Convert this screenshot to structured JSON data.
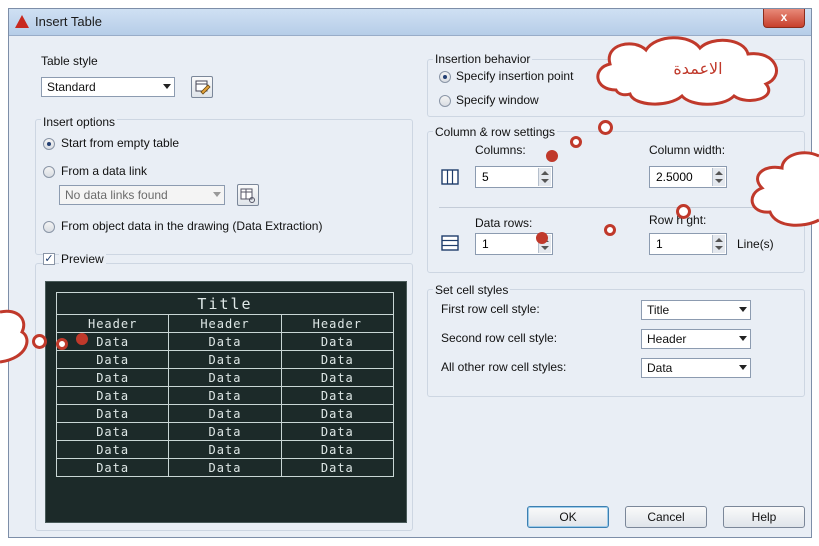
{
  "window": {
    "title": "Insert Table",
    "close_label": "x"
  },
  "table_style": {
    "heading": "Table style",
    "value": "Standard"
  },
  "insert_options": {
    "heading": "Insert options",
    "empty_table": "Start from empty table",
    "data_link": "From a data link",
    "data_link_combo": "No data links found",
    "object_data": "From object data in the drawing (Data Extraction)"
  },
  "preview": {
    "label": "Preview",
    "checked": true,
    "title": "Title",
    "headers": [
      "Header",
      "Header",
      "Header"
    ],
    "data_cell": "Data"
  },
  "insertion_behavior": {
    "heading": "Insertion behavior",
    "point": "Specify insertion point",
    "window": "Specify window"
  },
  "column_row": {
    "heading": "Column & row settings",
    "columns_label": "Columns:",
    "columns_value": "5",
    "column_width_label": "Column width:",
    "column_width_value": "2.5000",
    "data_rows_label": "Data rows:",
    "data_rows_value": "1",
    "row_height_label": "Row height:",
    "row_height_visible": "Row h    ght:",
    "row_height_value": "1",
    "lines_unit": "Line(s)"
  },
  "cell_styles": {
    "heading": "Set cell styles",
    "first_label": "First row cell style:",
    "first_value": "Title",
    "second_label": "Second row cell style:",
    "second_value": "Header",
    "other_label": "All other row cell styles:",
    "other_value": "Data"
  },
  "buttons": {
    "ok": "OK",
    "cancel": "Cancel",
    "help": "Help"
  },
  "annotation": {
    "arabic_text": "الاعمدة"
  },
  "colors": {
    "annotation": "#c0392b",
    "preview_bg": "#1c2a29",
    "dialog_bg": "#e9eef5"
  }
}
